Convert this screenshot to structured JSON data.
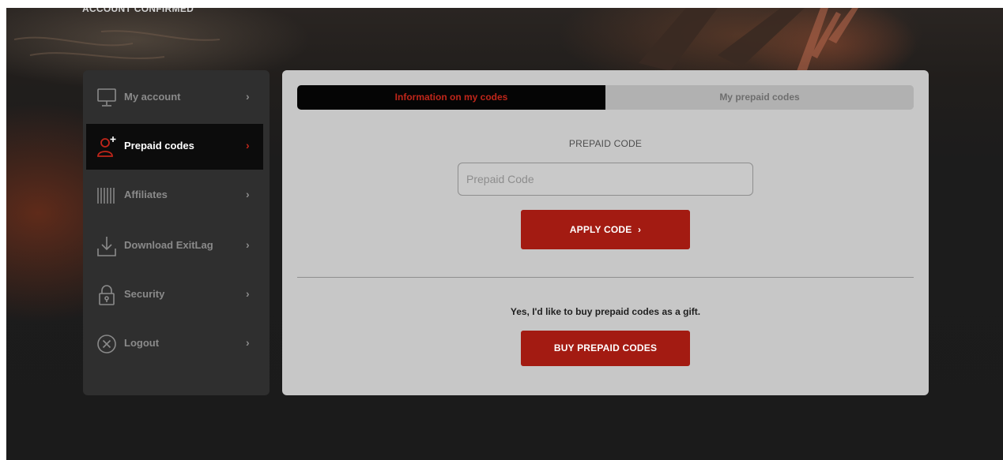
{
  "header": {
    "status_text": "ACCOUNT CONFIRMED"
  },
  "sidebar": {
    "items": [
      {
        "label": "My account",
        "icon": "monitor-icon",
        "active": false
      },
      {
        "label": "Prepaid codes",
        "icon": "user-plus-icon",
        "active": true
      },
      {
        "label": "Affiliates",
        "icon": "barcode-icon",
        "active": false
      },
      {
        "label": "Download ExitLag",
        "icon": "download-icon",
        "active": false
      },
      {
        "label": "Security",
        "icon": "lock-icon",
        "active": false
      },
      {
        "label": "Logout",
        "icon": "close-circle-icon",
        "active": false
      }
    ],
    "chevron": "›"
  },
  "main": {
    "tabs": [
      {
        "label": "Information on my codes",
        "active": true
      },
      {
        "label": "My prepaid codes",
        "active": false
      }
    ],
    "code_label": "PREPAID CODE",
    "code_input": {
      "value": "",
      "placeholder": "Prepaid Code"
    },
    "apply_button_label": "APPLY CODE",
    "apply_button_arrow": "›",
    "gift_text": "Yes, I'd like to buy prepaid codes as a gift.",
    "buy_button_label": "BUY PREPAID CODES"
  },
  "colors": {
    "accent_red": "#a31b12",
    "active_tab_text": "#c0261a",
    "panel_bg": "#c7c7c7",
    "sidebar_bg": "#2f2f2f",
    "page_bg": "#1b1b1b"
  }
}
